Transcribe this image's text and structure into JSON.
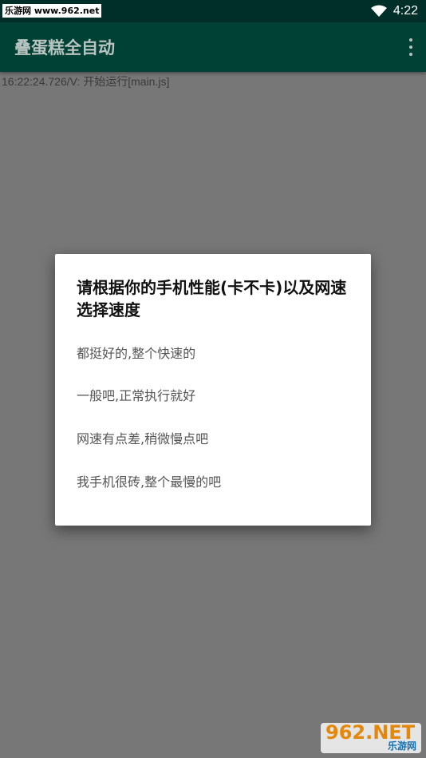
{
  "status_bar": {
    "watermark": "乐游网 www.962.net",
    "time": "4:22",
    "icons": [
      "wifi-icon"
    ]
  },
  "app_bar": {
    "title": "叠蛋糕全自动",
    "menu_icon": "more-vert-icon"
  },
  "log": {
    "line": "16:22:24.726/V: 开始运行[main.js]"
  },
  "dialog": {
    "title": "请根据你的手机性能(卡不卡)以及网速选择速度",
    "items": [
      {
        "label": "都挺好的,整个快速的"
      },
      {
        "label": "一般吧,正常执行就好"
      },
      {
        "label": "网速有点差,稍微慢点吧"
      },
      {
        "label": "我手机很砖,整个最慢的吧"
      }
    ]
  },
  "watermark_bottom": {
    "big": "962.NET",
    "small": "乐游网"
  },
  "colors": {
    "status_bar": "#002f29",
    "app_bar": "#004136",
    "scrim": "#777777",
    "dialog_bg": "#ffffff"
  }
}
